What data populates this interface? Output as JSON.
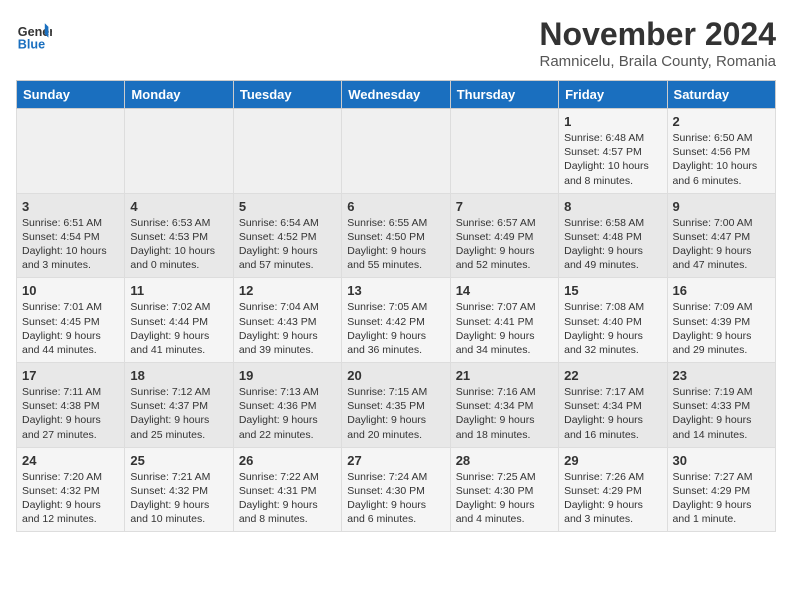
{
  "logo": {
    "general": "General",
    "blue": "Blue"
  },
  "header": {
    "month": "November 2024",
    "location": "Ramnicelu, Braila County, Romania"
  },
  "days_of_week": [
    "Sunday",
    "Monday",
    "Tuesday",
    "Wednesday",
    "Thursday",
    "Friday",
    "Saturday"
  ],
  "weeks": [
    [
      {
        "day": "",
        "info": ""
      },
      {
        "day": "",
        "info": ""
      },
      {
        "day": "",
        "info": ""
      },
      {
        "day": "",
        "info": ""
      },
      {
        "day": "",
        "info": ""
      },
      {
        "day": "1",
        "info": "Sunrise: 6:48 AM\nSunset: 4:57 PM\nDaylight: 10 hours and 8 minutes."
      },
      {
        "day": "2",
        "info": "Sunrise: 6:50 AM\nSunset: 4:56 PM\nDaylight: 10 hours and 6 minutes."
      }
    ],
    [
      {
        "day": "3",
        "info": "Sunrise: 6:51 AM\nSunset: 4:54 PM\nDaylight: 10 hours and 3 minutes."
      },
      {
        "day": "4",
        "info": "Sunrise: 6:53 AM\nSunset: 4:53 PM\nDaylight: 10 hours and 0 minutes."
      },
      {
        "day": "5",
        "info": "Sunrise: 6:54 AM\nSunset: 4:52 PM\nDaylight: 9 hours and 57 minutes."
      },
      {
        "day": "6",
        "info": "Sunrise: 6:55 AM\nSunset: 4:50 PM\nDaylight: 9 hours and 55 minutes."
      },
      {
        "day": "7",
        "info": "Sunrise: 6:57 AM\nSunset: 4:49 PM\nDaylight: 9 hours and 52 minutes."
      },
      {
        "day": "8",
        "info": "Sunrise: 6:58 AM\nSunset: 4:48 PM\nDaylight: 9 hours and 49 minutes."
      },
      {
        "day": "9",
        "info": "Sunrise: 7:00 AM\nSunset: 4:47 PM\nDaylight: 9 hours and 47 minutes."
      }
    ],
    [
      {
        "day": "10",
        "info": "Sunrise: 7:01 AM\nSunset: 4:45 PM\nDaylight: 9 hours and 44 minutes."
      },
      {
        "day": "11",
        "info": "Sunrise: 7:02 AM\nSunset: 4:44 PM\nDaylight: 9 hours and 41 minutes."
      },
      {
        "day": "12",
        "info": "Sunrise: 7:04 AM\nSunset: 4:43 PM\nDaylight: 9 hours and 39 minutes."
      },
      {
        "day": "13",
        "info": "Sunrise: 7:05 AM\nSunset: 4:42 PM\nDaylight: 9 hours and 36 minutes."
      },
      {
        "day": "14",
        "info": "Sunrise: 7:07 AM\nSunset: 4:41 PM\nDaylight: 9 hours and 34 minutes."
      },
      {
        "day": "15",
        "info": "Sunrise: 7:08 AM\nSunset: 4:40 PM\nDaylight: 9 hours and 32 minutes."
      },
      {
        "day": "16",
        "info": "Sunrise: 7:09 AM\nSunset: 4:39 PM\nDaylight: 9 hours and 29 minutes."
      }
    ],
    [
      {
        "day": "17",
        "info": "Sunrise: 7:11 AM\nSunset: 4:38 PM\nDaylight: 9 hours and 27 minutes."
      },
      {
        "day": "18",
        "info": "Sunrise: 7:12 AM\nSunset: 4:37 PM\nDaylight: 9 hours and 25 minutes."
      },
      {
        "day": "19",
        "info": "Sunrise: 7:13 AM\nSunset: 4:36 PM\nDaylight: 9 hours and 22 minutes."
      },
      {
        "day": "20",
        "info": "Sunrise: 7:15 AM\nSunset: 4:35 PM\nDaylight: 9 hours and 20 minutes."
      },
      {
        "day": "21",
        "info": "Sunrise: 7:16 AM\nSunset: 4:34 PM\nDaylight: 9 hours and 18 minutes."
      },
      {
        "day": "22",
        "info": "Sunrise: 7:17 AM\nSunset: 4:34 PM\nDaylight: 9 hours and 16 minutes."
      },
      {
        "day": "23",
        "info": "Sunrise: 7:19 AM\nSunset: 4:33 PM\nDaylight: 9 hours and 14 minutes."
      }
    ],
    [
      {
        "day": "24",
        "info": "Sunrise: 7:20 AM\nSunset: 4:32 PM\nDaylight: 9 hours and 12 minutes."
      },
      {
        "day": "25",
        "info": "Sunrise: 7:21 AM\nSunset: 4:32 PM\nDaylight: 9 hours and 10 minutes."
      },
      {
        "day": "26",
        "info": "Sunrise: 7:22 AM\nSunset: 4:31 PM\nDaylight: 9 hours and 8 minutes."
      },
      {
        "day": "27",
        "info": "Sunrise: 7:24 AM\nSunset: 4:30 PM\nDaylight: 9 hours and 6 minutes."
      },
      {
        "day": "28",
        "info": "Sunrise: 7:25 AM\nSunset: 4:30 PM\nDaylight: 9 hours and 4 minutes."
      },
      {
        "day": "29",
        "info": "Sunrise: 7:26 AM\nSunset: 4:29 PM\nDaylight: 9 hours and 3 minutes."
      },
      {
        "day": "30",
        "info": "Sunrise: 7:27 AM\nSunset: 4:29 PM\nDaylight: 9 hours and 1 minute."
      }
    ]
  ]
}
